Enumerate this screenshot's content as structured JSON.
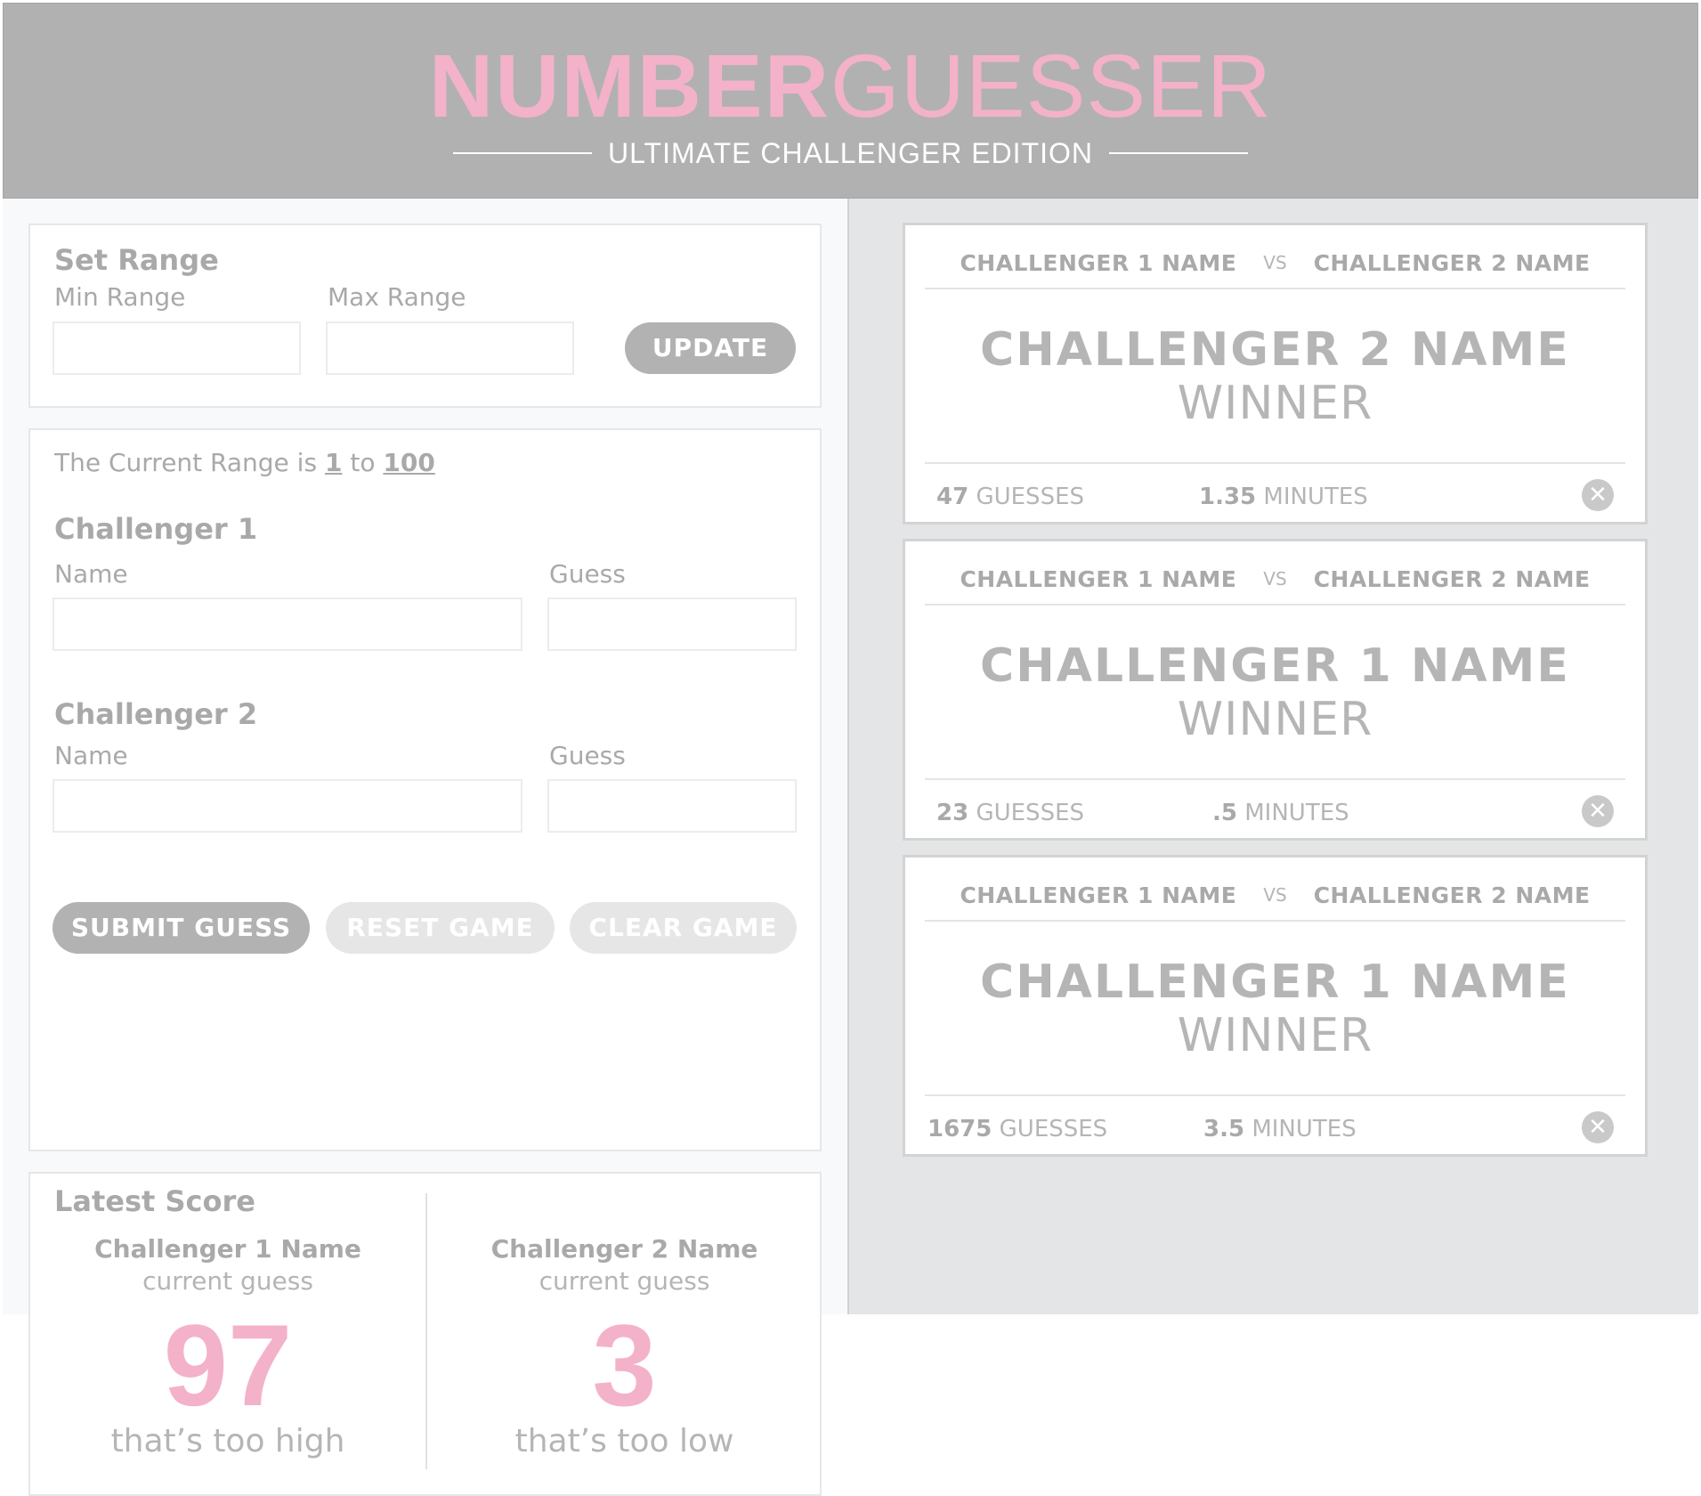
{
  "header": {
    "title_bold": "NUMBER",
    "title_light": "GUESSER",
    "subtitle": "ULTIMATE CHALLENGER EDITION"
  },
  "set_range": {
    "heading": "Set Range",
    "min_label": "Min Range",
    "max_label": "Max Range",
    "min_value": "",
    "max_value": "",
    "update_button": "UPDATE"
  },
  "game": {
    "range_prefix": "The Current Range is",
    "range_min": "1",
    "range_to": "to",
    "range_max": "100",
    "challenger1": {
      "heading": "Challenger 1",
      "name_label": "Name",
      "guess_label": "Guess",
      "name_value": "",
      "guess_value": ""
    },
    "challenger2": {
      "heading": "Challenger 2",
      "name_label": "Name",
      "guess_label": "Guess",
      "name_value": "",
      "guess_value": ""
    },
    "submit_button": "SUBMIT GUESS",
    "reset_button": "RESET GAME",
    "clear_button": "CLEAR GAME"
  },
  "latest_score": {
    "heading": "Latest Score",
    "left": {
      "name": "Challenger 1 Name",
      "sub": "current guess",
      "number": "97",
      "hint": "that’s too high"
    },
    "right": {
      "name": "Challenger 2 Name",
      "sub": "current guess",
      "number": "3",
      "hint": "that’s too low"
    }
  },
  "results": [
    {
      "c1": "CHALLENGER 1 NAME",
      "vs": "VS",
      "c2": "CHALLENGER 2 NAME",
      "winner_name": "CHALLENGER 2 NAME",
      "winner_word": "WINNER",
      "guesses": "47",
      "guesses_label": "GUESSES",
      "minutes": "1.35",
      "minutes_label": "MINUTES",
      "close_icon": "close-icon"
    },
    {
      "c1": "CHALLENGER 1 NAME",
      "vs": "VS",
      "c2": "CHALLENGER 2 NAME",
      "winner_name": "CHALLENGER 1 NAME",
      "winner_word": "WINNER",
      "guesses": "23",
      "guesses_label": "GUESSES",
      "minutes": ".5",
      "minutes_label": "MINUTES",
      "close_icon": "close-icon"
    },
    {
      "c1": "CHALLENGER 1 NAME",
      "vs": "VS",
      "c2": "CHALLENGER 2 NAME",
      "winner_name": "CHALLENGER 1 NAME",
      "winner_word": "WINNER",
      "guesses": "1675",
      "guesses_label": "GUESSES",
      "minutes": "3.5",
      "minutes_label": "MINUTES",
      "close_icon": "close-icon"
    }
  ],
  "colors": {
    "accent_pink": "#f3b2c9",
    "header_gray": "#b1b1b1",
    "text_gray": "#a9a9a9"
  }
}
